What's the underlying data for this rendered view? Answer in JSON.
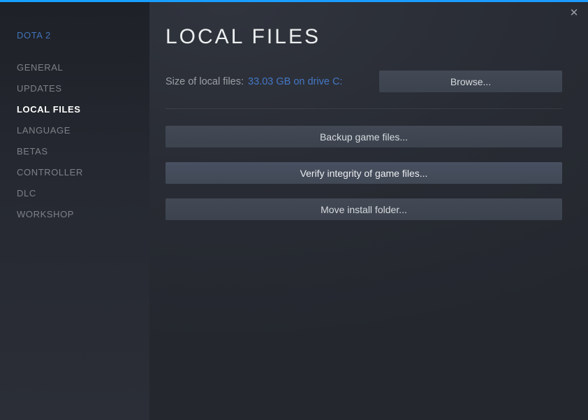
{
  "window": {
    "close_icon": "✕"
  },
  "sidebar": {
    "game_title": "DOTA 2",
    "items": [
      {
        "label": "GENERAL"
      },
      {
        "label": "UPDATES"
      },
      {
        "label": "LOCAL FILES"
      },
      {
        "label": "LANGUAGE"
      },
      {
        "label": "BETAS"
      },
      {
        "label": "CONTROLLER"
      },
      {
        "label": "DLC"
      },
      {
        "label": "WORKSHOP"
      }
    ],
    "active_item": "LOCAL FILES"
  },
  "main": {
    "title": "LOCAL FILES",
    "size_label": "Size of local files:",
    "size_value": "33.03 GB on drive C:",
    "browse_label": "Browse...",
    "buttons": [
      "Backup game files...",
      "Verify integrity of game files...",
      "Move install folder..."
    ]
  },
  "colors": {
    "accent_top_bar": "#18a0ff",
    "link_blue": "#4478c6",
    "sidebar_inactive_text": "#7d8187",
    "sidebar_active_text": "#ffffff",
    "button_background": "#3e4450"
  }
}
